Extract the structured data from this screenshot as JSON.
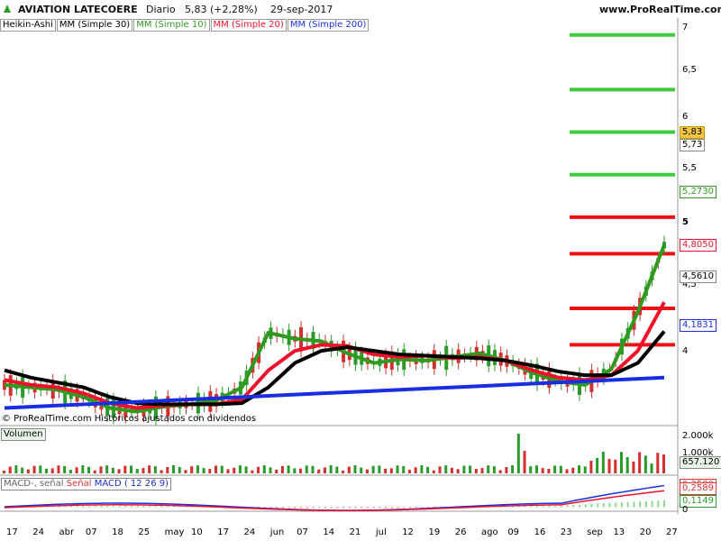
{
  "header": {
    "title": "AVIATION LATECOERE",
    "period": "Diario",
    "price_change": "5,83 (+2,28%)",
    "date": "29-sep-2017",
    "site": "www.ProRealTime.com"
  },
  "legend": [
    "Heikin-Ashi",
    "MM (Simple 30)",
    "MM (Simple 10)",
    "MM (Simple 20)",
    "MM (Simple 200)"
  ],
  "watermark": "© ProRealTime.com  Históricos ajustados con dividendos",
  "price_axis": {
    "ticks": [
      "7",
      "6,5",
      "6",
      "5,5",
      "5",
      "4,5",
      "4"
    ],
    "labels": {
      "last": "5,83",
      "ma30": "5,73",
      "ma10": "5,2730",
      "ma20": "4,8050",
      "ma30b": "4,5610",
      "ma200": "4,1831"
    }
  },
  "volume_panel": {
    "label": "Volumen",
    "ticks": [
      "2.000k",
      "1.000k"
    ],
    "last_label": "657.120"
  },
  "macd_panel": {
    "label_signal": "MACD-, señal",
    "label_senal": "Señal",
    "label_macd": "MACD ( 12 26 9)",
    "values": [
      "0,2589",
      "0,1149",
      "0,3580"
    ],
    "zero": "0"
  },
  "x_axis": [
    "17",
    "24",
    "abr",
    "07",
    "18",
    "25",
    "may",
    "10",
    "17",
    "24",
    "jun",
    "07",
    "14",
    "21",
    "jul",
    "12",
    "19",
    "26",
    "ago",
    "09",
    "16",
    "23",
    "sep",
    "13",
    "20",
    "27"
  ],
  "colors": {
    "ma10": "#2f9a1f",
    "ma20": "#f0102a",
    "ma30": "#000000",
    "ma200": "#1a2ee0",
    "level_green": "#3ecb3e",
    "level_red": "#ee1111",
    "candle_up": "#2a9a2a",
    "candle_down": "#d32f2f"
  },
  "chart_data": {
    "type": "line",
    "title": "AVIATION LATECOERE",
    "ylim": [
      3.8,
      7.05
    ],
    "x": [
      "17",
      "24",
      "abr",
      "07",
      "18",
      "25",
      "may",
      "10",
      "17",
      "24",
      "jun",
      "07",
      "14",
      "21",
      "jul",
      "12",
      "19",
      "26",
      "ago",
      "09",
      "16",
      "23",
      "sep",
      "13",
      "20",
      "27"
    ],
    "series": [
      {
        "name": "MM (Simple 10)",
        "values": [
          4.12,
          4.1,
          4.08,
          4.02,
          3.93,
          3.9,
          3.94,
          3.96,
          3.99,
          4.1,
          4.55,
          4.5,
          4.48,
          4.38,
          4.3,
          4.33,
          4.32,
          4.35,
          4.38,
          4.32,
          4.22,
          4.15,
          4.12,
          4.25,
          4.72,
          5.27
        ]
      },
      {
        "name": "MM (Simple 20)",
        "values": [
          4.16,
          4.12,
          4.1,
          4.05,
          3.97,
          3.93,
          3.95,
          3.96,
          3.96,
          4.0,
          4.24,
          4.4,
          4.45,
          4.44,
          4.37,
          4.35,
          4.36,
          4.34,
          4.35,
          4.32,
          4.24,
          4.18,
          4.16,
          4.2,
          4.4,
          4.8
        ]
      },
      {
        "name": "MM (Simple 30)",
        "values": [
          4.24,
          4.18,
          4.14,
          4.1,
          4.02,
          3.97,
          3.96,
          3.96,
          3.96,
          3.97,
          4.1,
          4.3,
          4.4,
          4.43,
          4.4,
          4.37,
          4.36,
          4.35,
          4.34,
          4.32,
          4.28,
          4.23,
          4.2,
          4.2,
          4.3,
          4.56
        ]
      },
      {
        "name": "MM (Simple 200)",
        "values": [
          3.93,
          3.94,
          3.95,
          3.96,
          3.97,
          3.98,
          3.99,
          4.0,
          4.01,
          4.02,
          4.03,
          4.04,
          4.05,
          4.06,
          4.07,
          4.08,
          4.09,
          4.1,
          4.11,
          4.12,
          4.13,
          4.14,
          4.15,
          4.16,
          4.17,
          4.18
        ]
      }
    ],
    "levels_green": [
      7.0,
      6.55,
      6.2,
      5.85
    ],
    "levels_red": [
      5.5,
      5.2,
      4.75,
      4.45
    ],
    "volume_last": 657120,
    "macd": [
      0.259,
      0.115
    ]
  }
}
